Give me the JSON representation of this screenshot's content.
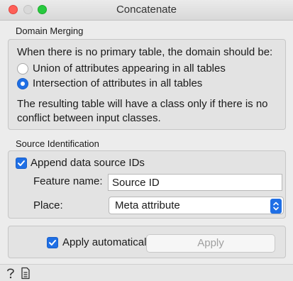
{
  "window": {
    "title": "Concatenate"
  },
  "domain_merging": {
    "label": "Domain Merging",
    "question": "When there is no primary table, the domain should be:",
    "options": [
      {
        "label": "Union of attributes appearing in all tables",
        "selected": false
      },
      {
        "label": "Intersection of attributes in all tables",
        "selected": true
      }
    ],
    "note_line1": "The resulting table will have a class only if there is no",
    "note_line2": "conflict between input classes."
  },
  "source_identification": {
    "label": "Source Identification",
    "append_label": "Append data source IDs",
    "append_checked": true,
    "feature_name_label": "Feature name:",
    "feature_name_value": "Source ID",
    "place_label": "Place:",
    "place_value": "Meta attribute"
  },
  "footer": {
    "apply_auto_label": "Apply automatically",
    "apply_auto_checked": true,
    "apply_button_label": "Apply"
  },
  "statusbar": {
    "icons": [
      "help-icon",
      "report-icon"
    ]
  },
  "colors": {
    "accent": "#1f6fe5",
    "close": "#fe5f57",
    "maximize": "#27c93f"
  }
}
